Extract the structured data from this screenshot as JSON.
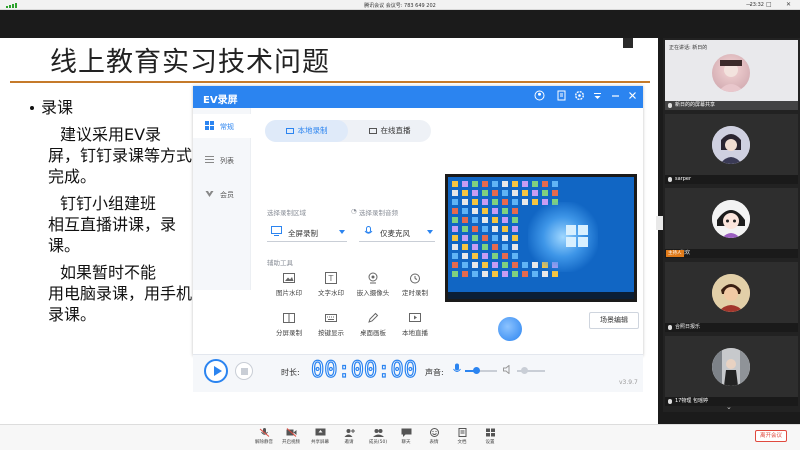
{
  "topbar": {
    "meeting_title": "腾讯会议 会议号: 783 649 202",
    "clock": "23:32",
    "min_symbol": "—",
    "max_symbol": "□",
    "close_symbol": "✕"
  },
  "slide": {
    "title": "线上教育实习技术问题",
    "bullet": "录课",
    "paragraphs": [
      {
        "first": "建议采用EV录",
        "rest": "屏，钉钉录课等方式完成。"
      },
      {
        "first": "钉钉小组建班",
        "rest": "相互直播讲课，录课。"
      },
      {
        "first": "如果暂时不能",
        "rest": "用电脑录课，用手机录课。"
      }
    ]
  },
  "ev": {
    "title": "EV录屏",
    "sidebar": [
      {
        "label": "常规",
        "icon": "grid-icon",
        "active": true
      },
      {
        "label": "列表",
        "icon": "list-icon",
        "active": false
      },
      {
        "label": "会员",
        "icon": "vip-icon",
        "active": false
      }
    ],
    "tabs": {
      "local": "本地录制",
      "live": "在线直播"
    },
    "region_label": "选择录制区域",
    "audio_label": "选择录制音频",
    "region_value": "全屏录制",
    "audio_value": "仅麦克风",
    "aux_label": "辅助工具",
    "tools": [
      {
        "label": "图片水印",
        "icon": "image-watermark-icon"
      },
      {
        "label": "文字水印",
        "icon": "text-watermark-icon"
      },
      {
        "label": "嵌入摄像头",
        "icon": "camera-icon"
      },
      {
        "label": "定时录制",
        "icon": "alarm-icon"
      },
      {
        "label": "分屏录制",
        "icon": "split-screen-icon"
      },
      {
        "label": "按键显示",
        "icon": "keyboard-icon"
      },
      {
        "label": "桌面画板",
        "icon": "pen-icon"
      },
      {
        "label": "本地直播",
        "icon": "local-live-icon"
      }
    ],
    "scene_button": "场景编辑",
    "duration_label": "时长:",
    "timer": "00:00:00",
    "volume_label": "声音:",
    "mic_level": 0.35,
    "speaker_level": 0.25,
    "version": "v3.9.7"
  },
  "participants": {
    "speaking_label": "正在讲话: 新日的",
    "members": [
      {
        "name": "新日的的屏幕共享",
        "badge": ""
      },
      {
        "name": "sarper",
        "badge": ""
      },
      {
        "name": "万紫欢",
        "badge": "主持人"
      },
      {
        "name": "合照日报乐",
        "badge": ""
      },
      {
        "name": "17物理 包瑶婷",
        "badge": ""
      }
    ],
    "more": "⌄"
  },
  "bottombar": {
    "buttons": [
      {
        "label": "解除静音",
        "icon": "mic-icon"
      },
      {
        "label": "开启视频",
        "icon": "video-icon"
      },
      {
        "label": "共享屏幕",
        "icon": "share-screen-icon"
      },
      {
        "label": "邀请",
        "icon": "invite-icon"
      },
      {
        "label": "成员(50)",
        "icon": "members-icon"
      },
      {
        "label": "聊天",
        "icon": "chat-icon"
      },
      {
        "label": "表情",
        "icon": "emoji-icon"
      },
      {
        "label": "文档",
        "icon": "document-icon"
      },
      {
        "label": "设置",
        "icon": "settings-icon"
      }
    ],
    "leave": "离开会议"
  },
  "colors": {
    "accent": "#2b84f0",
    "title_rule": "#c57a2a",
    "leave": "#e04a3f",
    "host_badge": "#e07b1a"
  }
}
